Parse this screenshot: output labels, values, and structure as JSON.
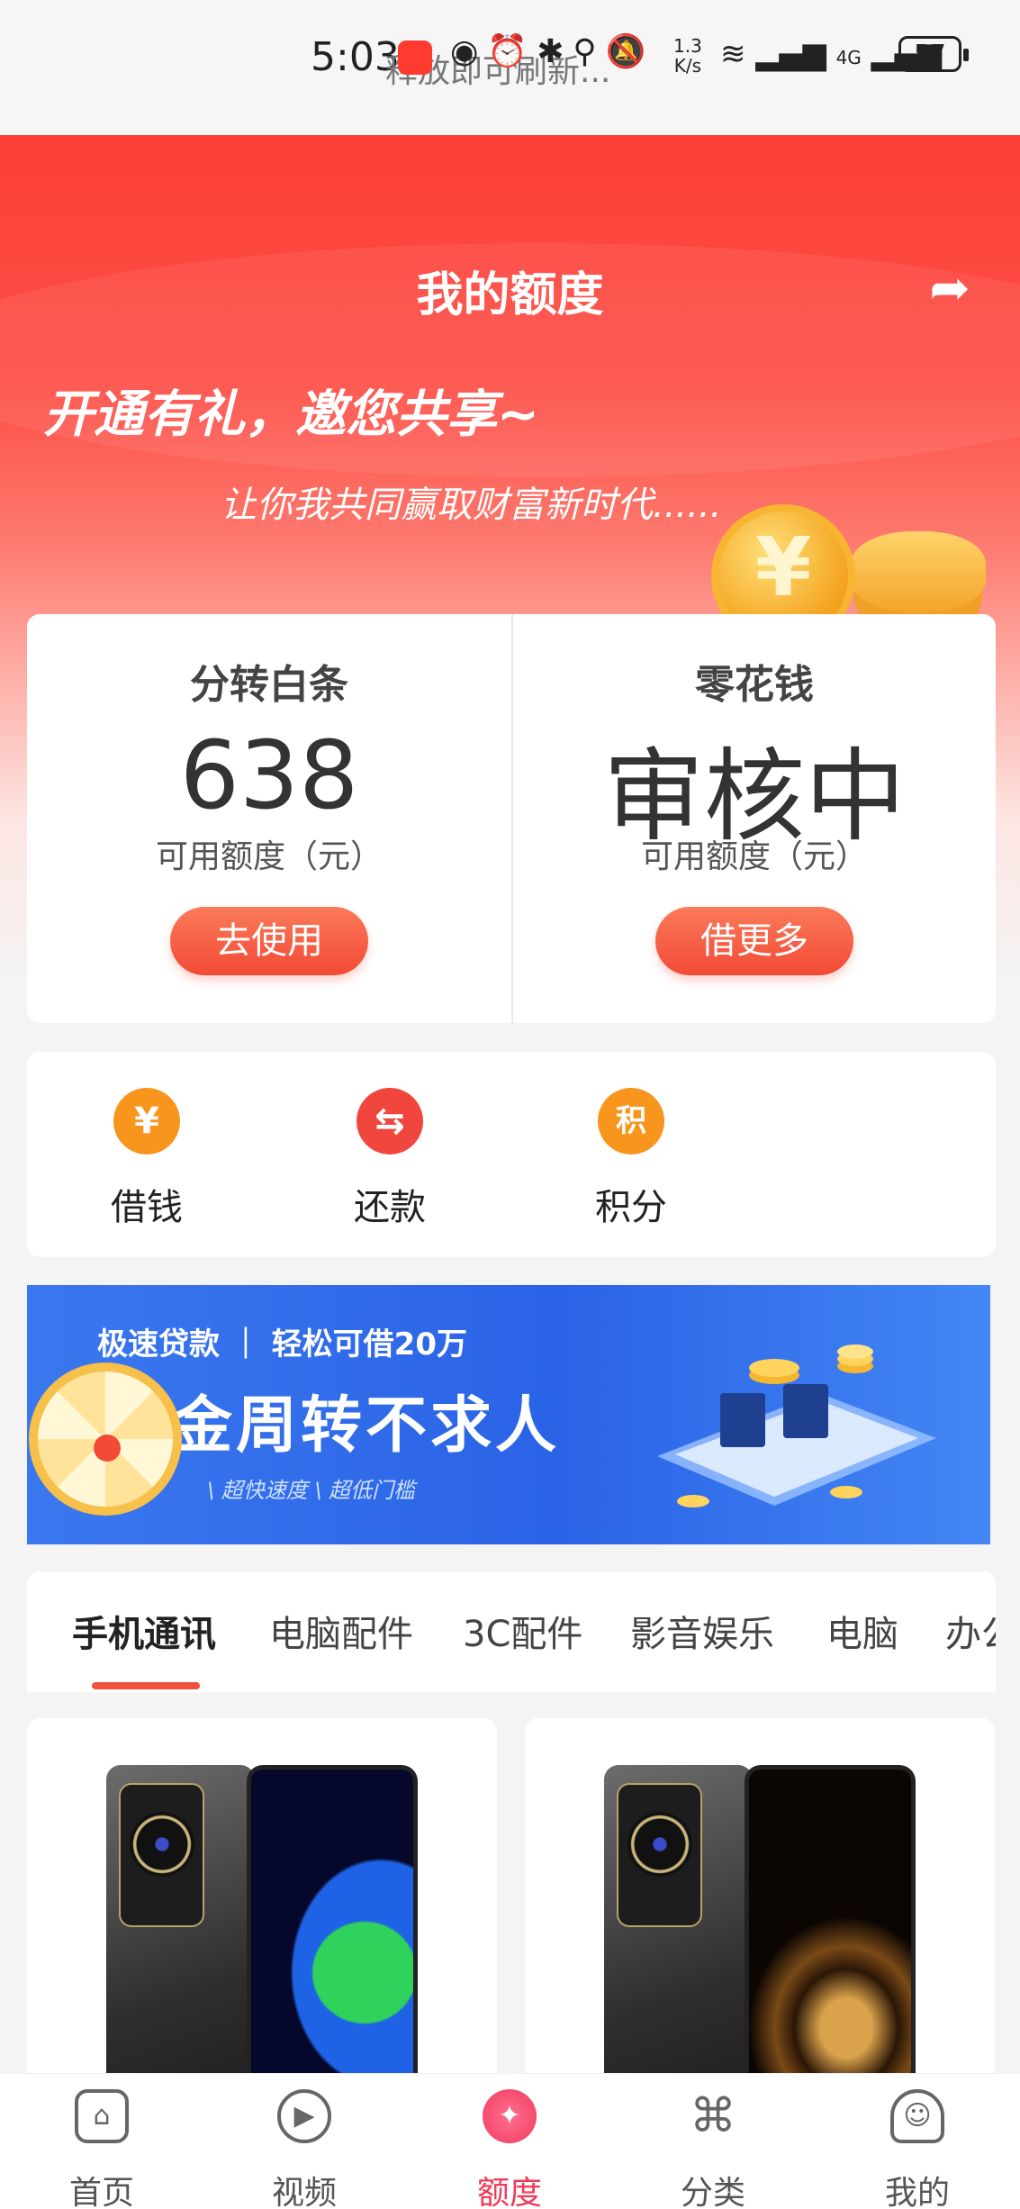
{
  "status_bar": {
    "time": "5:03",
    "ticker": "释放即可刷新...",
    "speed_value": "1.3",
    "speed_unit": "K/s",
    "signal_label": "4G",
    "battery": "57"
  },
  "header": {
    "title": "我的额度",
    "share_icon": "share-icon"
  },
  "hero": {
    "slogan": "开通有礼，邀您共享~",
    "subslogan": "让你我共同赢取财富新时代......",
    "coin_symbol": "¥"
  },
  "quota_cards": [
    {
      "name": "分转白条",
      "value": "638",
      "sub": "可用额度（元）",
      "button": "去使用"
    },
    {
      "name": "零花钱",
      "value": "审核中",
      "sub": "可用额度（元）",
      "button": "借更多"
    }
  ],
  "actions": [
    {
      "label": "借钱",
      "icon": "borrow-money-icon",
      "glyph": "¥",
      "color": "#f7951d"
    },
    {
      "label": "还款",
      "icon": "repay-bag-icon",
      "glyph": "⇆",
      "color": "#f0463e"
    },
    {
      "label": "积分",
      "icon": "points-icon",
      "glyph": "积",
      "color": "#f7951d"
    }
  ],
  "banner": {
    "tag": "极速贷款 ｜ 轻松可借20万",
    "main": "金周转不求人",
    "sub": "\\ 超快速度 \\ 超低门槛"
  },
  "tabs": [
    "手机通讯",
    "电脑配件",
    "3C配件",
    "影音娱乐",
    "电脑",
    "办公"
  ],
  "active_tab": 0,
  "bottom_nav": [
    {
      "label": "首页",
      "icon": "home-icon"
    },
    {
      "label": "视频",
      "icon": "video-play-icon"
    },
    {
      "label": "额度",
      "icon": "quota-icon"
    },
    {
      "label": "分类",
      "icon": "category-icon"
    },
    {
      "label": "我的",
      "icon": "profile-icon"
    }
  ],
  "active_nav": 2,
  "colors": {
    "brand_red": "#fb3f36",
    "button_orange": "#f24a35",
    "nav_active": "#f03a5a"
  }
}
